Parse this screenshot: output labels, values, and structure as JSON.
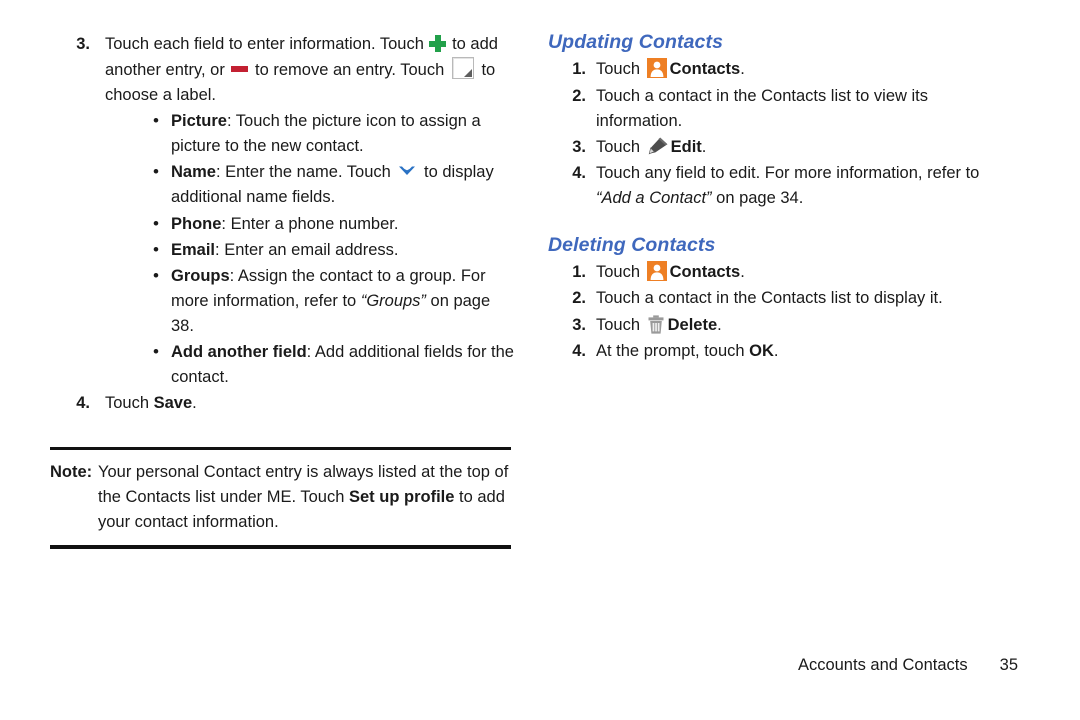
{
  "page": {
    "footer_chapter": "Accounts and Contacts",
    "footer_page_number": "35"
  },
  "colors": {
    "heading_blue": "#3f68bd",
    "plus_green": "#22a04a",
    "minus_red": "#c32032",
    "contacts_orange": "#ee7f24",
    "chevron_blue": "#2a72c4",
    "icon_gray": "#8a8a8a"
  },
  "left_column": {
    "step3": {
      "number": "3.",
      "text_a": "Touch each field to enter information. Touch ",
      "text_b": " to add another entry, or ",
      "text_c": " to remove an entry. Touch ",
      "text_d": " to choose a label.",
      "bullets": [
        {
          "term": "Picture",
          "text_a": ": Touch the picture icon to assign a picture to the new contact."
        },
        {
          "term": "Name",
          "text_a": ": Enter the name. Touch ",
          "text_b": " to display additional name fields."
        },
        {
          "term": "Phone",
          "text_a": ": Enter a phone number."
        },
        {
          "term": "Email",
          "text_a": ": Enter an email address."
        },
        {
          "term": "Groups",
          "text_a": ": Assign the contact to a group. For more information, refer to ",
          "ref": "“Groups”",
          "text_b": " on page 38."
        },
        {
          "term": "Add another field",
          "text_a": ": Add additional fields for the contact."
        }
      ]
    },
    "step4": {
      "number": "4.",
      "text_a": "Touch ",
      "bold": "Save",
      "text_b": "."
    },
    "note": {
      "label": "Note:",
      "text_a": "Your personal Contact entry is always listed at the top of the Contacts list under ME. Touch ",
      "bold": "Set up profile",
      "text_b": " to add your contact information."
    }
  },
  "right_column": {
    "updating": {
      "heading": "Updating Contacts",
      "steps": [
        {
          "number": "1.",
          "text_a": "Touch ",
          "icon": "contacts-icon",
          "bold": "Contacts",
          "text_b": "."
        },
        {
          "number": "2.",
          "text_a": "Touch a contact in the Contacts list to view its information."
        },
        {
          "number": "3.",
          "text_a": "Touch ",
          "icon": "edit-pencil-icon",
          "bold": "Edit",
          "text_b": "."
        },
        {
          "number": "4.",
          "text_a": "Touch any field to edit. For more information, refer to ",
          "ref": "“Add a Contact”",
          "text_b": " on page 34."
        }
      ]
    },
    "deleting": {
      "heading": "Deleting Contacts",
      "steps": [
        {
          "number": "1.",
          "text_a": "Touch ",
          "icon": "contacts-icon",
          "bold": "Contacts",
          "text_b": "."
        },
        {
          "number": "2.",
          "text_a": "Touch a contact in the Contacts list to display it."
        },
        {
          "number": "3.",
          "text_a": "Touch ",
          "icon": "trash-icon",
          "bold": "Delete",
          "text_b": "."
        },
        {
          "number": "4.",
          "text_a": "At the prompt, touch ",
          "bold": "OK",
          "text_b": "."
        }
      ]
    }
  },
  "icons": {
    "plus": "plus-icon",
    "minus": "minus-icon",
    "label_box": "label-chooser-icon",
    "chevron_down": "chevron-down-icon",
    "contacts": "contacts-icon",
    "edit": "edit-pencil-icon",
    "trash": "trash-icon",
    "bullet": "•"
  }
}
